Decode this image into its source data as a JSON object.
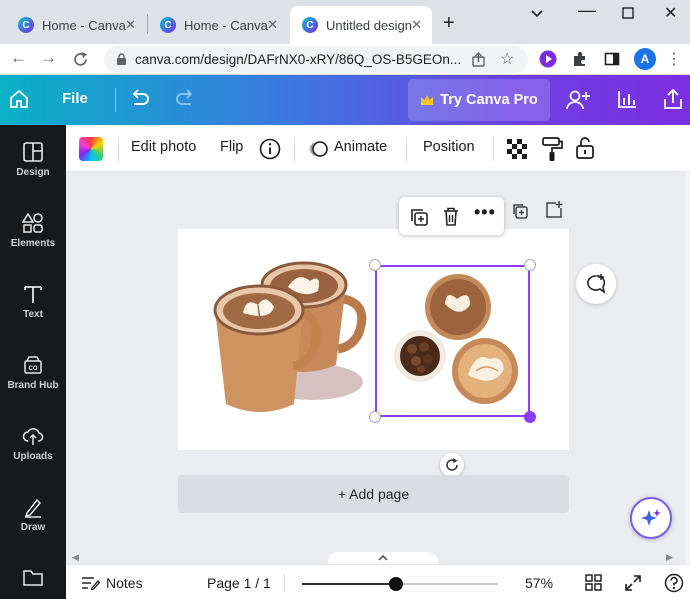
{
  "browser": {
    "tabs": [
      {
        "title": "Home - Canva",
        "active": false
      },
      {
        "title": "Home - Canva",
        "active": false
      },
      {
        "title": "Untitled design",
        "active": true
      }
    ],
    "url": "canva.com/design/DAFrNX0-xRY/86Q_OS-B5GEOn...",
    "profile_initial": "A"
  },
  "header": {
    "file_label": "File",
    "try_pro_label": "Try Canva Pro"
  },
  "sidebar": {
    "items": [
      {
        "label": "Design",
        "icon": "layout-icon"
      },
      {
        "label": "Elements",
        "icon": "shapes-icon"
      },
      {
        "label": "Text",
        "icon": "text-icon"
      },
      {
        "label": "Brand Hub",
        "icon": "brand-hub-icon"
      },
      {
        "label": "Uploads",
        "icon": "upload-cloud-icon"
      },
      {
        "label": "Draw",
        "icon": "pen-icon"
      },
      {
        "label": "",
        "icon": "folder-icon"
      }
    ]
  },
  "toolbar": {
    "edit_photo": "Edit photo",
    "flip": "Flip",
    "animate": "Animate",
    "position": "Position"
  },
  "canvas": {
    "add_page_label": "+ Add page"
  },
  "bottom": {
    "notes_label": "Notes",
    "page_indicator": "Page 1 / 1",
    "zoom_percent": "57%",
    "zoom_slider_level": 0.48
  },
  "colors": {
    "selection": "#8b3dff",
    "sidebar_bg": "#18191b"
  }
}
